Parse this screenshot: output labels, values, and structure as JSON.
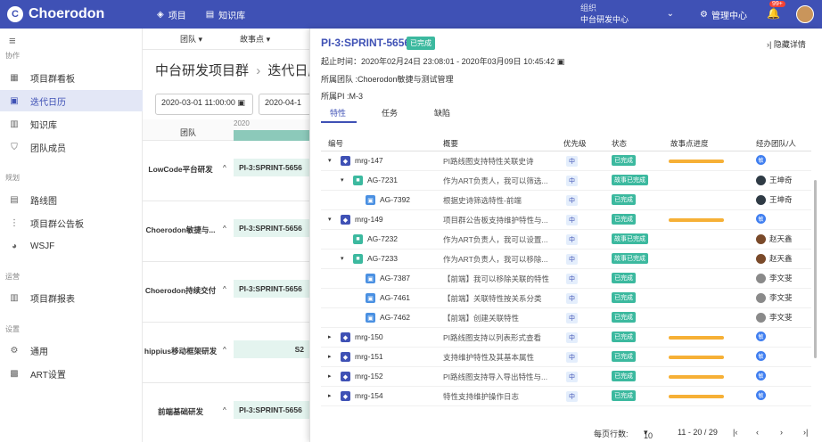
{
  "topbar": {
    "logo": "Choerodon",
    "nav": [
      {
        "label": "项目",
        "icon": "cube-icon"
      },
      {
        "label": "知识库",
        "icon": "book-icon"
      }
    ],
    "org_label": "组织",
    "org_name": "中台研发中心",
    "manage": "管理中心",
    "notif_count": "99+"
  },
  "sidebar": {
    "sections": [
      {
        "title": "协作",
        "items": [
          {
            "label": "项目群看板"
          },
          {
            "label": "迭代日历"
          },
          {
            "label": "知识库"
          },
          {
            "label": "团队成员"
          }
        ]
      },
      {
        "title": "规划",
        "items": [
          {
            "label": "路线图"
          },
          {
            "label": "项目群公告板"
          },
          {
            "label": "WSJF"
          }
        ]
      },
      {
        "title": "运营",
        "items": [
          {
            "label": "项目群报表"
          }
        ]
      },
      {
        "title": "设置",
        "items": [
          {
            "label": "通用"
          },
          {
            "label": "ART设置"
          }
        ]
      }
    ]
  },
  "main": {
    "filter_team": "团队",
    "filter_points": "故事点",
    "title_parent": "中台研发项目群",
    "title_sep": "›",
    "title_current": "迭代日历",
    "date_start": "2020-03-01 11:00:00",
    "date_end": "2020-04-1",
    "team_header": "团队",
    "year": "2020",
    "rows": [
      {
        "team": "LowCode平台研发",
        "sprint": "PI-3:SPRINT-5656"
      },
      {
        "team": "Choerodon敏捷与...",
        "sprint": "PI-3:SPRINT-5656"
      },
      {
        "team": "Choerodon持续交付",
        "sprint": "PI-3:SPRINT-5656"
      },
      {
        "team": "hippius移动框架研发",
        "sprint": "S2"
      },
      {
        "team": "前端基础研发",
        "sprint": "PI-3:SPRINT-5656"
      }
    ]
  },
  "panel": {
    "title": "PI-3:SPRINT-5656",
    "status": "已完成",
    "hide": "隐藏详情",
    "time_label": "起止时间：",
    "time": "2020年02月24日 23:08:01 - 2020年03月09日 10:45:42",
    "team": "所属团队 :Choerodon敏捷与测试管理",
    "pi": "所属PI :M-3",
    "tabs": [
      "特性",
      "任务",
      "缺陷"
    ],
    "columns": [
      "编号",
      "概要",
      "优先级",
      "状态",
      "故事点进度",
      "经办团队/人"
    ],
    "rows": [
      {
        "level": 0,
        "expand": "▾",
        "type": "feature",
        "id": "mrg-147",
        "summary": "PI路线图支持特性关联史诗",
        "priority": "中",
        "status": "已完成",
        "progress": 1,
        "owner": "敏",
        "owner_type": "team"
      },
      {
        "level": 1,
        "expand": "▾",
        "type": "story",
        "id": "AG-7231",
        "summary": "作为ART负责人，我可以筛选...",
        "priority": "中",
        "status": "故事已完成",
        "progress": 0,
        "owner": "王坤奇",
        "owner_type": "person"
      },
      {
        "level": 2,
        "expand": "",
        "type": "task",
        "id": "AG-7392",
        "summary": "根据史诗筛选特性-前端",
        "priority": "中",
        "status": "已完成",
        "progress": 0,
        "owner": "王坤奇",
        "owner_type": "person"
      },
      {
        "level": 0,
        "expand": "▾",
        "type": "feature",
        "id": "mrg-149",
        "summary": "项目群公告板支持维护特性与...",
        "priority": "中",
        "status": "已完成",
        "progress": 1,
        "owner": "敏",
        "owner_type": "team"
      },
      {
        "level": 1,
        "expand": "",
        "type": "story",
        "id": "AG-7232",
        "summary": "作为ART负责人，我可以设置...",
        "priority": "中",
        "status": "故事已完成",
        "progress": 0,
        "owner": "赵天鑫",
        "owner_type": "person"
      },
      {
        "level": 1,
        "expand": "▾",
        "type": "story",
        "id": "AG-7233",
        "summary": "作为ART负责人，我可以移除...",
        "priority": "中",
        "status": "故事已完成",
        "progress": 0,
        "owner": "赵天鑫",
        "owner_type": "person"
      },
      {
        "level": 2,
        "expand": "",
        "type": "task",
        "id": "AG-7387",
        "summary": "【前端】我可以移除关联的特性",
        "priority": "中",
        "status": "已完成",
        "progress": 0,
        "owner": "李文斐",
        "owner_type": "person"
      },
      {
        "level": 2,
        "expand": "",
        "type": "task",
        "id": "AG-7461",
        "summary": "【前端】关联特性按关系分类",
        "priority": "中",
        "status": "已完成",
        "progress": 0,
        "owner": "李文斐",
        "owner_type": "person"
      },
      {
        "level": 2,
        "expand": "",
        "type": "task",
        "id": "AG-7462",
        "summary": "【前端】创建关联特性",
        "priority": "中",
        "status": "已完成",
        "progress": 0,
        "owner": "李文斐",
        "owner_type": "person"
      },
      {
        "level": 0,
        "expand": "▸",
        "type": "feature",
        "id": "mrg-150",
        "summary": "PI路线图支持以列表形式查看",
        "priority": "中",
        "status": "已完成",
        "progress": 1,
        "owner": "敏",
        "owner_type": "team"
      },
      {
        "level": 0,
        "expand": "▸",
        "type": "feature",
        "id": "mrg-151",
        "summary": "支持维护特性及其基本属性",
        "priority": "中",
        "status": "已完成",
        "progress": 1,
        "owner": "敏",
        "owner_type": "team"
      },
      {
        "level": 0,
        "expand": "▸",
        "type": "feature",
        "id": "mrg-152",
        "summary": "PI路线图支持导入导出特性与...",
        "priority": "中",
        "status": "已完成",
        "progress": 1,
        "owner": "敏",
        "owner_type": "team"
      },
      {
        "level": 0,
        "expand": "▸",
        "type": "feature",
        "id": "mrg-154",
        "summary": "特性支持维护操作日志",
        "priority": "中",
        "status": "已完成",
        "progress": 1,
        "owner": "敏",
        "owner_type": "team"
      }
    ],
    "pager": {
      "rows_label": "每页行数:",
      "rows_value": "10",
      "range": "11 - 20 / 29"
    },
    "colors": {
      "accent": "#3f51b5",
      "done": "#3cb99f",
      "bar": "#f6b036",
      "feature": "#3f51b5",
      "story": "#3cb99f",
      "task": "#4a90e2"
    }
  }
}
